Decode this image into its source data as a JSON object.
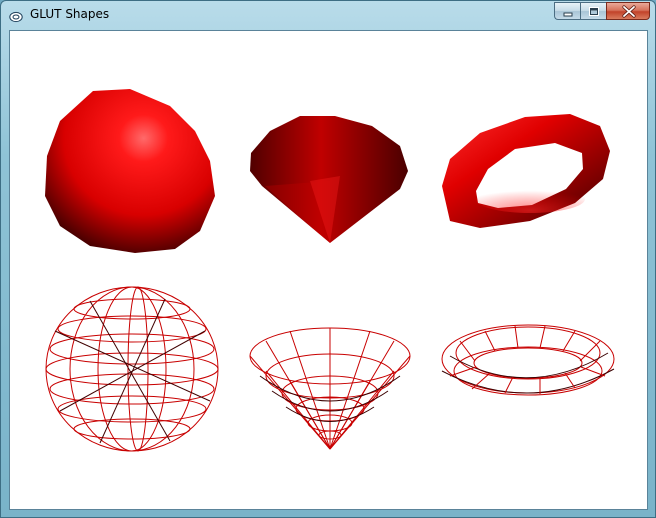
{
  "window": {
    "title": "GLUT Shapes"
  },
  "caption_buttons": [
    "minimize",
    "maximize",
    "close"
  ],
  "scene": {
    "background": "#ffffff",
    "solid_color": "#ff0000",
    "wire_color": "#cc0000",
    "shapes": [
      {
        "name": "solid-sphere",
        "style": "solid"
      },
      {
        "name": "solid-cone",
        "style": "solid"
      },
      {
        "name": "solid-torus",
        "style": "solid"
      },
      {
        "name": "wire-sphere",
        "style": "wireframe"
      },
      {
        "name": "wire-cone",
        "style": "wireframe"
      },
      {
        "name": "wire-torus",
        "style": "wireframe"
      }
    ]
  }
}
